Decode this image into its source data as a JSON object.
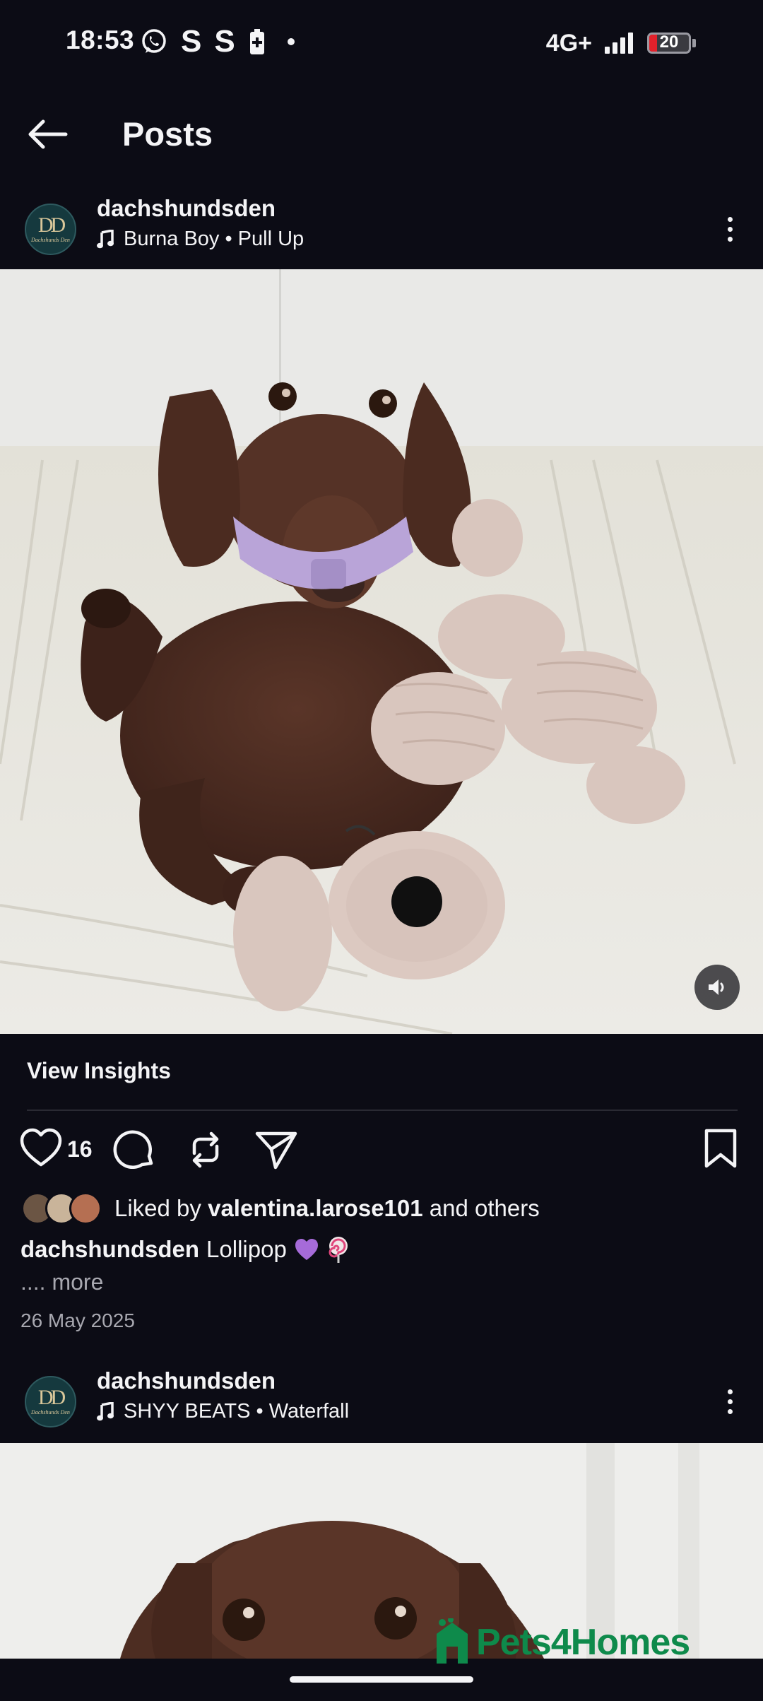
{
  "status_bar": {
    "time": "18:53",
    "network": "4G+",
    "battery": "20",
    "battery_level": 0.2,
    "left_icons": [
      "whatsapp-icon",
      "s-app-icon",
      "s-app-icon",
      "battery-saver-icon",
      "dot-icon"
    ],
    "right_icons": [
      "signal-icon",
      "battery-icon"
    ]
  },
  "header": {
    "title": "Posts",
    "back_icon": "arrow-left-icon"
  },
  "post1": {
    "username": "dachshundsden",
    "music": "Burna Boy • Pull Up",
    "view_insights": "View Insights",
    "like_count": "16",
    "liked_by_prefix": "Liked by ",
    "liked_by_user": "valentina.larose101",
    "liked_by_suffix": " and others",
    "caption_user": "dachshundsden",
    "caption_text": "Lollipop",
    "more": ".... more",
    "date": "26 May 2025"
  },
  "post2": {
    "username": "dachshundsden",
    "music": "SHYY BEATS • Waterfall"
  },
  "avatar": {
    "monogram": "DD",
    "subtext": "Dachshunds Den"
  },
  "watermark": {
    "text": "Pets4Homes"
  },
  "colors": {
    "background": "#0c0c15",
    "text": "#f4f4f6",
    "muted": "#a8a8b0",
    "battery_low": "#e2212b",
    "watermark": "#0e8a4b",
    "avatar_bg": "#15393e"
  }
}
